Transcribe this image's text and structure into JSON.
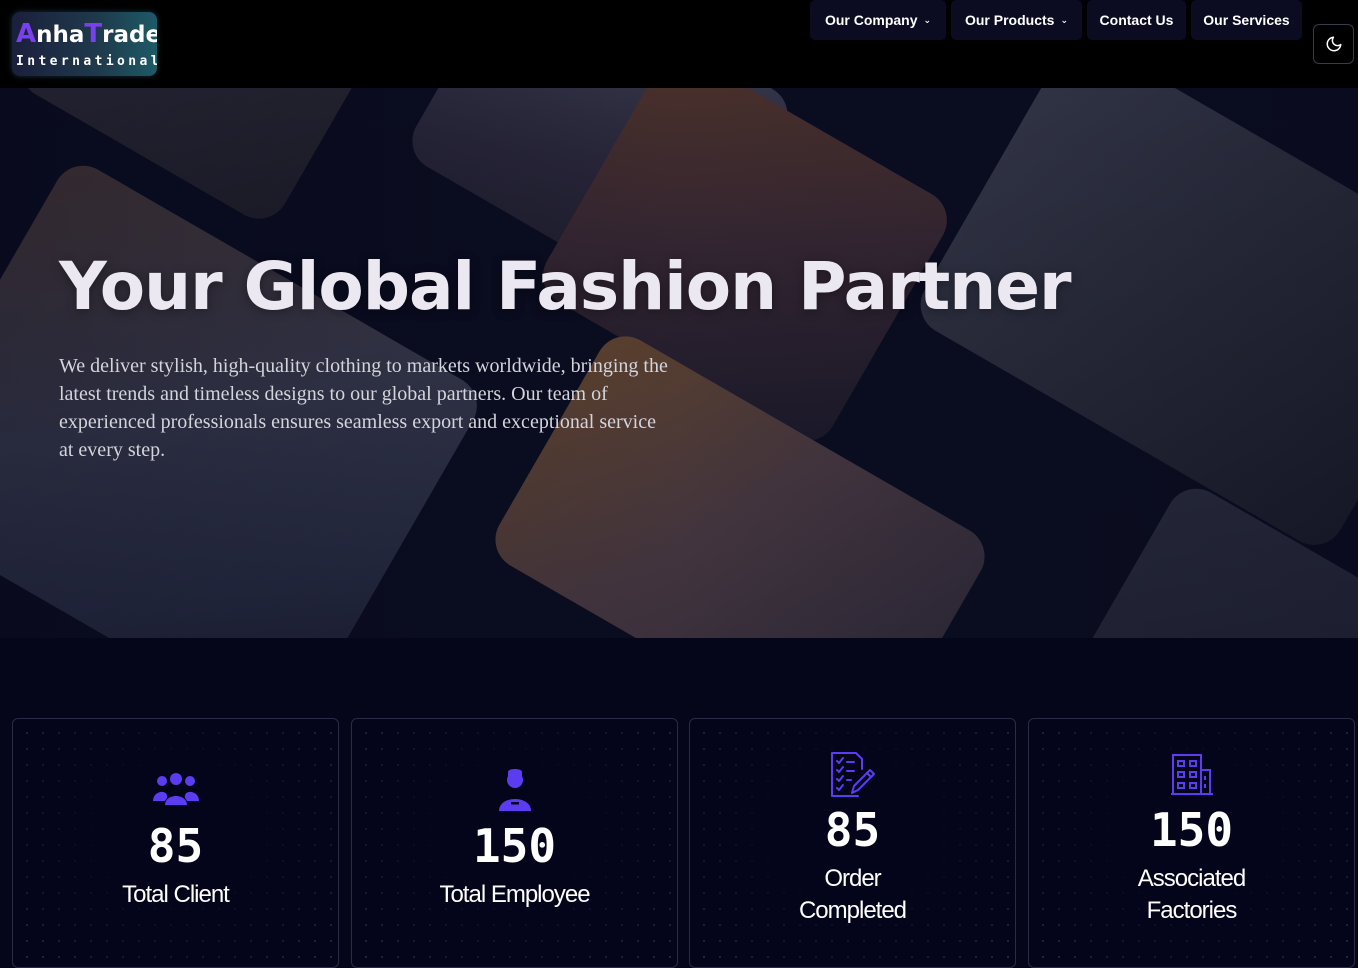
{
  "brand": {
    "logo_first_a": "A",
    "logo_first_rest": "nha",
    "logo_second_t": "T",
    "logo_second_rest": "rade",
    "logo_sub": "International"
  },
  "nav": {
    "items": [
      {
        "label": "Our Company",
        "has_dropdown": true
      },
      {
        "label": "Our Products",
        "has_dropdown": true
      },
      {
        "label": "Contact Us",
        "has_dropdown": false
      },
      {
        "label": "Our Services",
        "has_dropdown": false
      }
    ],
    "theme_toggle_icon": "moon-icon"
  },
  "hero": {
    "title": "Your Global Fashion Partner",
    "text_lines": [
      "We deliver stylish, high-quality clothing to markets worldwide, bringing the",
      "latest trends and timeless designs to our global partners. Our team of",
      "experienced professionals ensures seamless export and exceptional service",
      "at every step."
    ]
  },
  "stats": [
    {
      "value": "85",
      "label_lines": [
        "Total Client"
      ],
      "icon": "users-group-icon"
    },
    {
      "value": "150",
      "label_lines": [
        "Total Employee"
      ],
      "icon": "employee-icon"
    },
    {
      "value": "85",
      "label_lines": [
        "Order",
        "Completed"
      ],
      "icon": "checklist-edit-icon"
    },
    {
      "value": "150",
      "label_lines": [
        "Associated",
        "Factories"
      ],
      "icon": "building-icon"
    }
  ],
  "colors": {
    "accent": "#5b3cf0",
    "background": "#05061a",
    "navbar": "#000000"
  }
}
